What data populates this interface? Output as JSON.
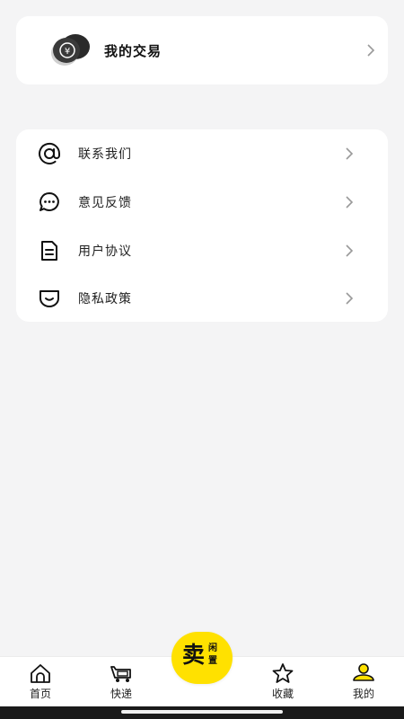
{
  "trade": {
    "title": "我的交易",
    "icon": "coin-stack-icon"
  },
  "menu": [
    {
      "label": "联系我们",
      "icon": "at-sign-icon"
    },
    {
      "label": "意见反馈",
      "icon": "chat-bubble-icon"
    },
    {
      "label": "用户协议",
      "icon": "document-icon"
    },
    {
      "label": "隐私政策",
      "icon": "shield-icon"
    }
  ],
  "tabbar": {
    "home": "首页",
    "express": "快递",
    "sell_main": "卖",
    "sell_sub1": "闲",
    "sell_sub2": "置",
    "favorites": "收藏",
    "mine": "我的"
  },
  "colors": {
    "accent": "#ffe100",
    "background": "#f4f4f5",
    "card": "#ffffff"
  }
}
